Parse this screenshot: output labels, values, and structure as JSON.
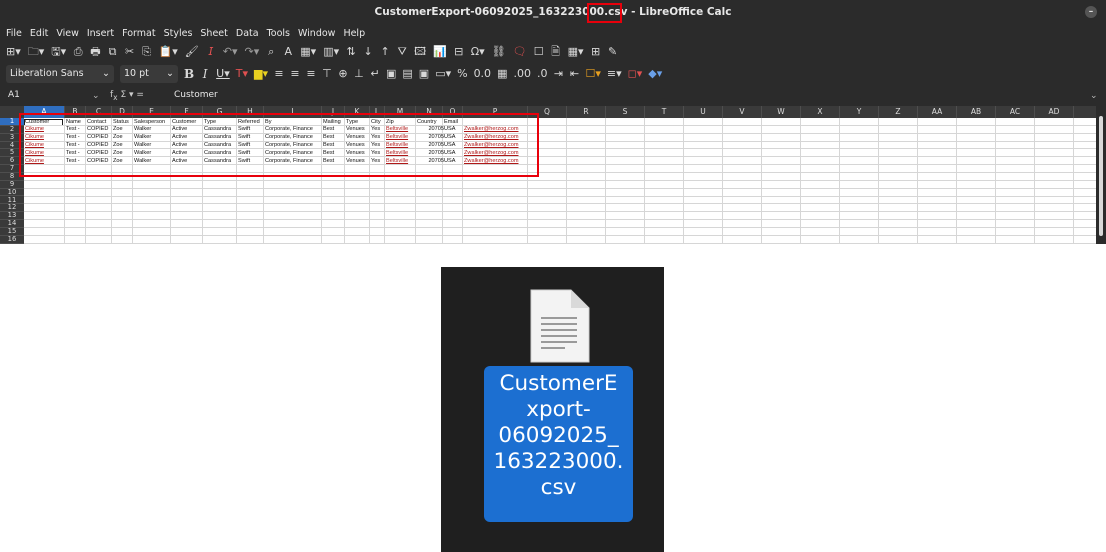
{
  "window": {
    "title_file": "CustomerExport-06092025_163223000.csv",
    "title_app": " - LibreOffice Calc"
  },
  "menu": [
    "File",
    "Edit",
    "View",
    "Insert",
    "Format",
    "Styles",
    "Sheet",
    "Data",
    "Tools",
    "Window",
    "Help"
  ],
  "format_bar": {
    "font_name": "Liberation Sans",
    "font_size": "10 pt"
  },
  "formula_bar": {
    "cell_ref": "A1",
    "content": "Customer"
  },
  "columns": [
    "A",
    "B",
    "C",
    "D",
    "E",
    "F",
    "G",
    "H",
    "I",
    "J",
    "K",
    "L",
    "M",
    "N",
    "O",
    "P",
    "Q",
    "R",
    "S",
    "T",
    "U",
    "V",
    "W",
    "X",
    "Y",
    "Z",
    "AA",
    "AB",
    "AC",
    "AD"
  ],
  "rows": [
    "1",
    "2",
    "3",
    "4",
    "5",
    "6",
    "7",
    "8",
    "9",
    "10",
    "11",
    "12",
    "13",
    "14",
    "15",
    "16"
  ],
  "sheet": {
    "header": [
      "Customer",
      "Name",
      "Contact",
      "Status",
      "Salesperson",
      "Customer",
      "Type",
      "Referred",
      "By",
      "Mailing",
      "Type",
      "City",
      "Zip",
      "Country",
      "Email",
      ""
    ],
    "records": [
      [
        "Cikume",
        "Test -",
        "COPIED",
        "Zoe",
        "Walker",
        "Active",
        "Cassandra",
        "Swift",
        "Corporate, Finance",
        "Best",
        "Venues",
        "Yes",
        "Beltsville",
        "20705",
        "USA",
        "Zwalker@herzog.com"
      ],
      [
        "Cikume",
        "Test -",
        "COPIED",
        "Zoe",
        "Walker",
        "Active",
        "Cassandra",
        "Swift",
        "Corporate, Finance",
        "Best",
        "Venues",
        "Yes",
        "Beltsville",
        "20705",
        "USA",
        "Zwalker@herzog.com"
      ],
      [
        "Cikume",
        "Test -",
        "COPIED",
        "Zoe",
        "Walker",
        "Active",
        "Cassandra",
        "Swift",
        "Corporate, Finance",
        "Best",
        "Venues",
        "Yes",
        "Beltsville",
        "20705",
        "USA",
        "Zwalker@herzog.com"
      ],
      [
        "Cikume",
        "Test -",
        "COPIED",
        "Zoe",
        "Walker",
        "Active",
        "Cassandra",
        "Swift",
        "Corporate, Finance",
        "Best",
        "Venues",
        "Yes",
        "Beltsville",
        "20705",
        "USA",
        "Zwalker@herzog.com"
      ],
      [
        "Cikume",
        "Test -",
        "COPIED",
        "Zoe",
        "Walker",
        "Active",
        "Cassandra",
        "Swift",
        "Corporate, Finance",
        "Best",
        "Venues",
        "Yes",
        "Beltsville",
        "20705",
        "USA",
        "Zwalker@herzog.com"
      ]
    ]
  },
  "file_icon": {
    "label_lines": [
      "CustomerE",
      "xport-",
      "06092025_",
      "163223000.",
      "csv"
    ],
    "icon": "text-document-icon"
  },
  "colors": {
    "highlight_box": "#e8000b",
    "selection_blue": "#1c6fd1",
    "toolbar_bg": "#2b2b2b",
    "link_red": "#b01818"
  }
}
